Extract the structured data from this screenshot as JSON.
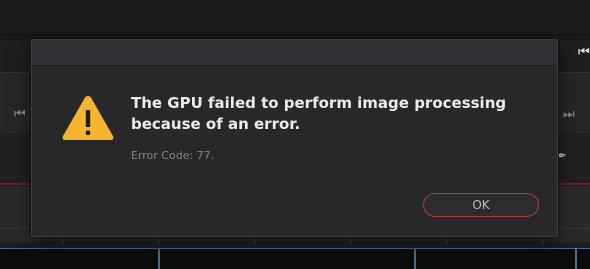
{
  "dialog": {
    "message": "The GPU failed to perform image processing because of an error.",
    "error_code": "Error Code: 77.",
    "ok_label": "OK"
  },
  "icons": {
    "warning": "warning-triangle-icon",
    "skip_start_left": "skip-to-start-icon",
    "skip_end_right": "skip-to-end-icon",
    "top_right": "skip-to-start-icon",
    "tool": "eyedropper-icon"
  },
  "colors": {
    "warning": "#f5b52f",
    "ok_border": "#b63a3f",
    "playhead_line": "#6b2326",
    "clip_border": "#4b6e92"
  }
}
